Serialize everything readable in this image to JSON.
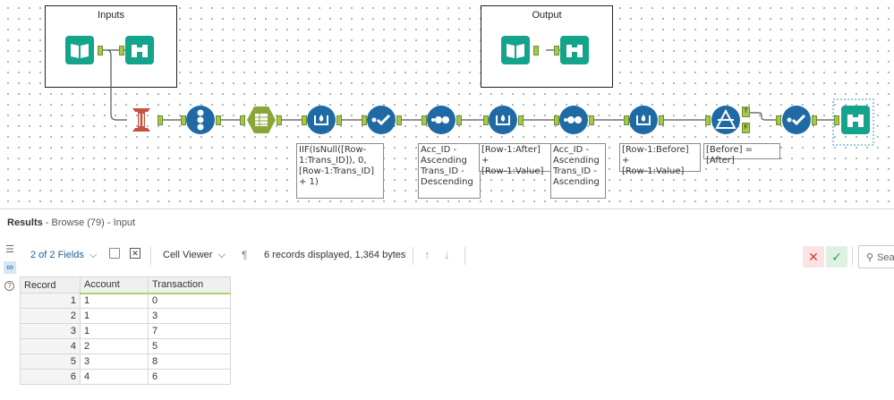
{
  "containers": {
    "inputs_title": "Inputs",
    "output_title": "Output"
  },
  "annotations": {
    "multirow_trans_id": "IIF(IsNull([Row-\n1:Trans_ID]), 0,\n[Row-1:Trans_ID]\n+ 1)",
    "sort_desc": "Acc_ID -\nAscending\nTrans_ID -\nDescending",
    "multirow_after": "[Row-1:After] +\n[Row-1:Value]",
    "sort_asc": "Acc_ID -\nAscending\nTrans_ID -\nAscending",
    "multirow_before": "[Row-1:Before] +\n[Row-1:Value]",
    "filter_expr": "[Before] = [After]"
  },
  "filter_anchors": {
    "true": "T",
    "false": "F"
  },
  "results": {
    "title": "Results",
    "subtitle": " - Browse (79) - Input"
  },
  "toolbar": {
    "fields": "2 of 2 Fields",
    "cell_viewer": "Cell Viewer",
    "records_info": "6 records displayed, 1,364 bytes",
    "search_placeholder": "Sea"
  },
  "icons": {
    "list": "list-icon",
    "binoculars": "binoculars-icon",
    "help": "help-icon",
    "checkbox": "checkbox-icon",
    "deselect": "deselect-icon",
    "paragraph": "pilcrow-icon",
    "up": "arrow-up-icon",
    "down": "arrow-down-icon",
    "cancel": "x-icon",
    "apply": "check-icon",
    "search": "search-icon"
  },
  "colors": {
    "tool_blue": "#1f6aa5",
    "tool_teal": "#14a38b",
    "tool_red": "#c8513e",
    "tool_olive": "#8aa63a",
    "anchor_green": "#a5c84b"
  },
  "table": {
    "headers": [
      "Record",
      "Account",
      "Transaction"
    ],
    "rows": [
      [
        "1",
        "1",
        "0"
      ],
      [
        "2",
        "1",
        "3"
      ],
      [
        "3",
        "1",
        "7"
      ],
      [
        "4",
        "2",
        "5"
      ],
      [
        "5",
        "3",
        "8"
      ],
      [
        "6",
        "4",
        "6"
      ]
    ]
  }
}
